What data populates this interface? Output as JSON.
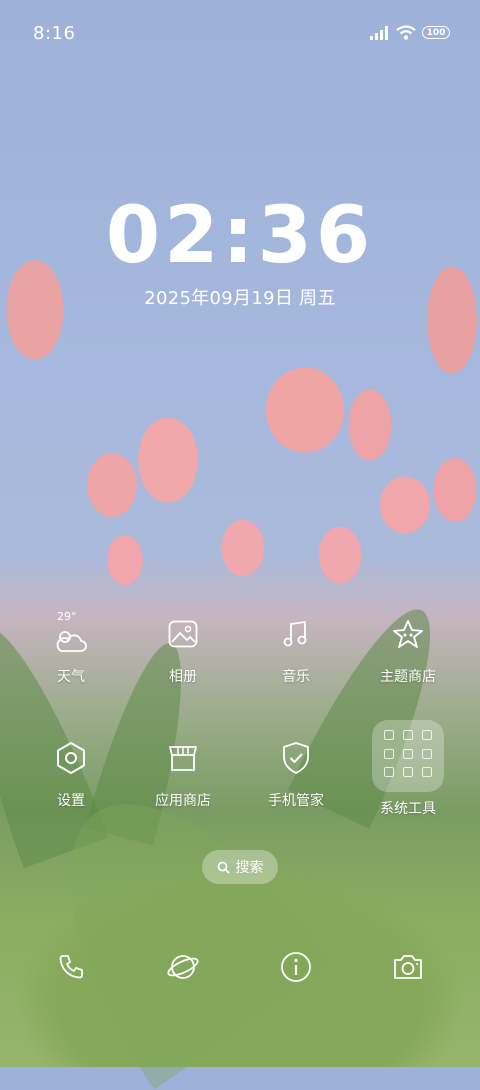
{
  "status_bar": {
    "time": "8:16",
    "battery": "100"
  },
  "clock": {
    "time": "02:36",
    "date": "2025年09月19日  周五"
  },
  "weather_widget": {
    "temperature": "29°"
  },
  "apps_row1": [
    {
      "label": "天气",
      "icon": "weather-icon"
    },
    {
      "label": "相册",
      "icon": "gallery-icon"
    },
    {
      "label": "音乐",
      "icon": "music-icon"
    },
    {
      "label": "主题商店",
      "icon": "theme-store-icon"
    }
  ],
  "apps_row2": [
    {
      "label": "设置",
      "icon": "settings-icon"
    },
    {
      "label": "应用商店",
      "icon": "app-store-icon"
    },
    {
      "label": "手机管家",
      "icon": "phone-manager-icon"
    },
    {
      "label": "系统工具",
      "icon": "system-tools-folder"
    }
  ],
  "search": {
    "label": "搜索"
  },
  "dock": [
    {
      "icon": "phone-icon"
    },
    {
      "icon": "browser-icon"
    },
    {
      "icon": "info-icon"
    },
    {
      "icon": "camera-icon"
    }
  ],
  "colors": {
    "accent": "#ffffff",
    "sky": "#a6b8dd",
    "tulip": "#f0a6a6",
    "leaf": "#7a9c63"
  }
}
